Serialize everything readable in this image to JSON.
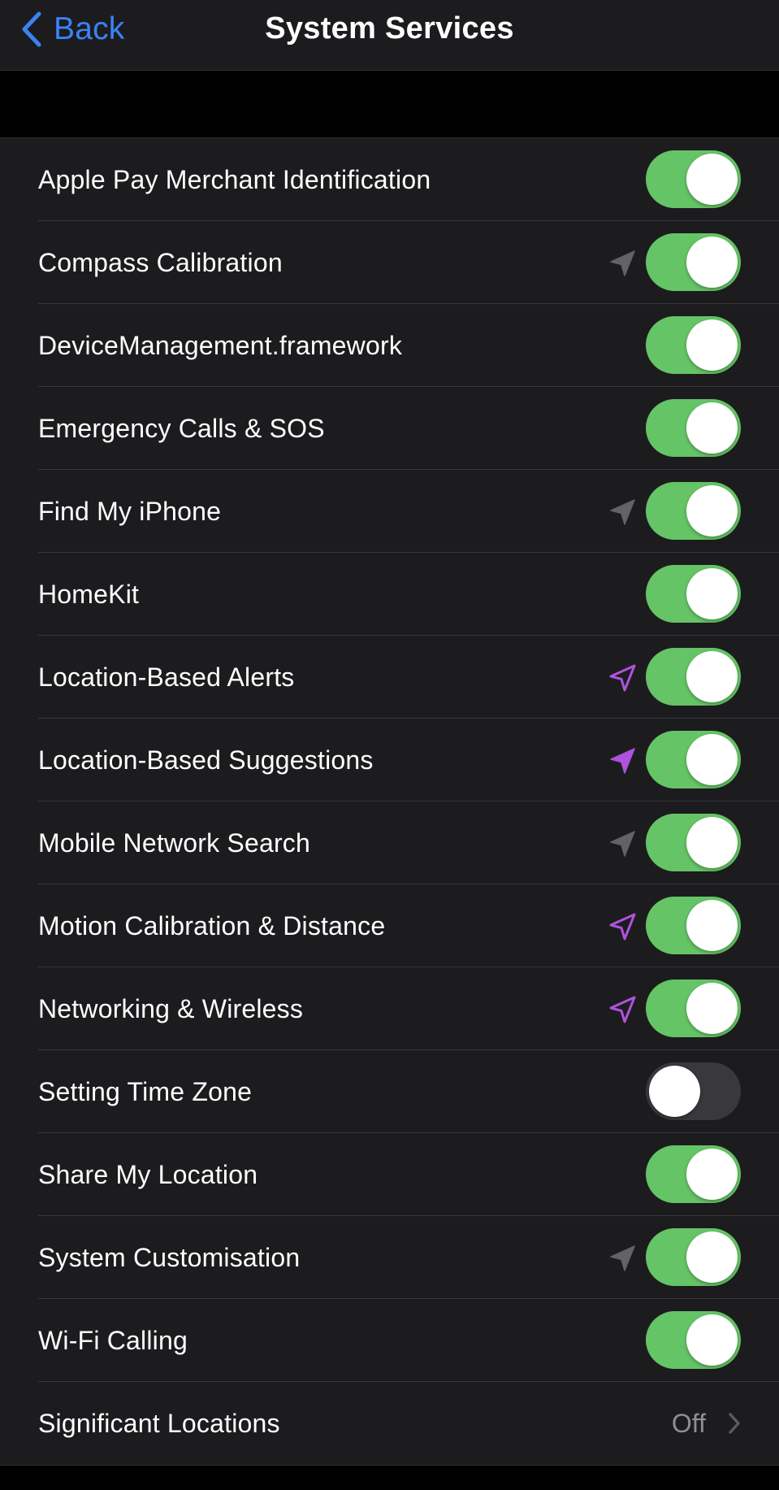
{
  "nav": {
    "back_label": "Back",
    "title": "System Services"
  },
  "colors": {
    "accent_blue": "#3b82f6",
    "toggle_on": "#65c466",
    "toggle_off": "#39393d",
    "location_gray": "#636366",
    "location_purple": "#af52de"
  },
  "services": [
    {
      "label": "Apple Pay Merchant Identification",
      "on": true,
      "location_icon": "none"
    },
    {
      "label": "Compass Calibration",
      "on": true,
      "location_icon": "gray-filled"
    },
    {
      "label": "DeviceManagement.framework",
      "on": true,
      "location_icon": "none"
    },
    {
      "label": "Emergency Calls & SOS",
      "on": true,
      "location_icon": "none"
    },
    {
      "label": "Find My iPhone",
      "on": true,
      "location_icon": "gray-filled"
    },
    {
      "label": "HomeKit",
      "on": true,
      "location_icon": "none"
    },
    {
      "label": "Location-Based Alerts",
      "on": true,
      "location_icon": "purple-outline"
    },
    {
      "label": "Location-Based Suggestions",
      "on": true,
      "location_icon": "purple-filled"
    },
    {
      "label": "Mobile Network Search",
      "on": true,
      "location_icon": "gray-filled"
    },
    {
      "label": "Motion Calibration & Distance",
      "on": true,
      "location_icon": "purple-outline"
    },
    {
      "label": "Networking & Wireless",
      "on": true,
      "location_icon": "purple-outline"
    },
    {
      "label": "Setting Time Zone",
      "on": false,
      "location_icon": "none"
    },
    {
      "label": "Share My Location",
      "on": true,
      "location_icon": "none"
    },
    {
      "label": "System Customisation",
      "on": true,
      "location_icon": "gray-filled"
    },
    {
      "label": "Wi-Fi Calling",
      "on": true,
      "location_icon": "none"
    }
  ],
  "significant_locations": {
    "label": "Significant Locations",
    "value": "Off"
  }
}
